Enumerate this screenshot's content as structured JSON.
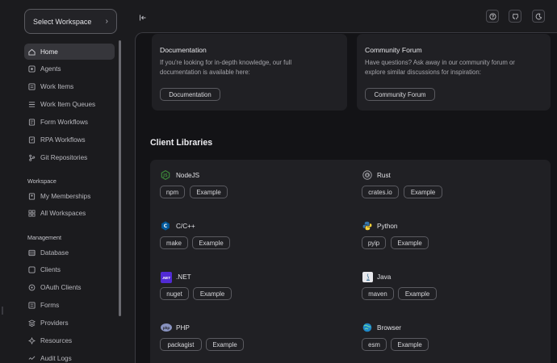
{
  "workspace_select": {
    "label": "Select Workspace"
  },
  "nav_main": [
    {
      "label": "Home",
      "icon": "home-icon",
      "active": true
    },
    {
      "label": "Agents",
      "icon": "agents-icon"
    },
    {
      "label": "Work Items",
      "icon": "work-items-icon"
    },
    {
      "label": "Work Item Queues",
      "icon": "queue-icon"
    },
    {
      "label": "Form Workflows",
      "icon": "form-workflow-icon"
    },
    {
      "label": "RPA Workflows",
      "icon": "rpa-icon"
    },
    {
      "label": "Git Repositories",
      "icon": "git-icon"
    }
  ],
  "section_workspace": "Workspace",
  "nav_workspace": [
    {
      "label": "My Memberships",
      "icon": "membership-icon"
    },
    {
      "label": "All Workspaces",
      "icon": "workspaces-icon"
    }
  ],
  "section_management": "Management",
  "nav_management": [
    {
      "label": "Database",
      "icon": "database-icon"
    },
    {
      "label": "Clients",
      "icon": "clients-icon"
    },
    {
      "label": "OAuth Clients",
      "icon": "oauth-icon"
    },
    {
      "label": "Forms",
      "icon": "forms-icon"
    },
    {
      "label": "Providers",
      "icon": "providers-icon"
    },
    {
      "label": "Resources",
      "icon": "resources-icon"
    },
    {
      "label": "Audit Logs",
      "icon": "audit-icon"
    }
  ],
  "documentation": {
    "title": "Documentation",
    "text_1": "If you're looking for in-depth knowledge, our full",
    "text_2": "documentation is available here:",
    "button": "Documentation"
  },
  "community": {
    "title": "Community Forum",
    "text_1": "Have questions? Ask away in our community forum or",
    "text_2": "explore similar discussions for inspiration:",
    "button": "Community Forum"
  },
  "client_libraries": {
    "heading": "Client Libraries",
    "libs": [
      {
        "name": "NodeJS",
        "pkg": "npm",
        "example": "Example",
        "icon": "nodejs-icon"
      },
      {
        "name": "Rust",
        "pkg": "crates.io",
        "example": "Example",
        "icon": "rust-icon"
      },
      {
        "name": "C/C++",
        "pkg": "make",
        "example": "Example",
        "icon": "cpp-icon"
      },
      {
        "name": "Python",
        "pkg": "pyip",
        "example": "Example",
        "icon": "python-icon"
      },
      {
        "name": ".NET",
        "pkg": "nuget",
        "example": "Example",
        "icon": "dotnet-icon",
        "logo_text": ".NET"
      },
      {
        "name": "Java",
        "pkg": "maven",
        "example": "Example",
        "icon": "java-icon"
      },
      {
        "name": "PHP",
        "pkg": "packagist",
        "example": "Example",
        "icon": "php-icon",
        "logo_text": "php"
      },
      {
        "name": "Browser",
        "pkg": "esm",
        "example": "Example",
        "icon": "browser-icon"
      }
    ]
  },
  "colors": {
    "background": "#1b1b1e",
    "main_panel": "#131316",
    "card": "#202024",
    "active_nav": "#36363b",
    "nodejs": "#3c873a",
    "dotnet": "#512bd4",
    "python_blue": "#3776ab",
    "python_yellow": "#ffd43b"
  }
}
